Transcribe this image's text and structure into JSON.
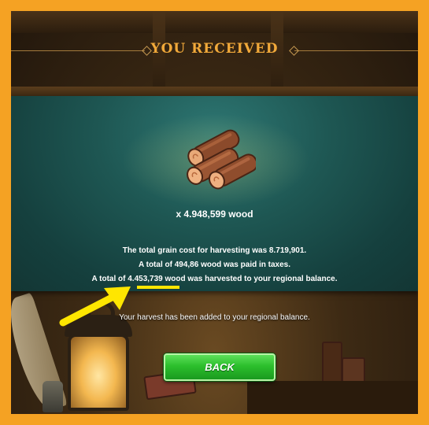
{
  "dialog": {
    "title": "YOU RECEIVED",
    "reward_amount": "x 4.948,599 wood",
    "cost_line": "The total grain cost for harvesting was 8.719,901.",
    "tax_line": "A total of 494,86 wood was paid in taxes.",
    "harvest_line_prefix": "A total of ",
    "harvest_line_value": "4.453,739",
    "harvest_line_suffix": " wood was harvested to your regional balance.",
    "note": "Your harvest has been added to your regional balance.",
    "back_label": "BACK"
  },
  "colors": {
    "frame_border": "#f5a223",
    "title": "#f1a93a",
    "panel": "#1e5753",
    "button": "#2cbf2c",
    "highlight": "#ffe600"
  },
  "icons": {
    "reward": "wood-logs-icon",
    "annotation": "yellow-arrow-icon"
  }
}
